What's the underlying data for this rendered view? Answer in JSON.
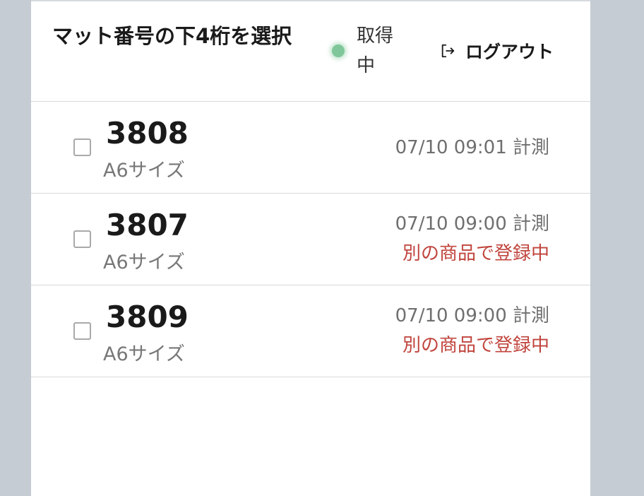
{
  "header": {
    "title": "マット番号の下4桁を選択",
    "status": {
      "label": "取得中",
      "color": "#7fc79a"
    },
    "logout": {
      "label": "ログアウト",
      "icon": "logout-icon"
    }
  },
  "mats": [
    {
      "number": "3808",
      "size": "A6サイズ",
      "measured": "07/10 09:01 計測",
      "warning": "",
      "checked": false
    },
    {
      "number": "3807",
      "size": "A6サイズ",
      "measured": "07/10 09:00 計測",
      "warning": "別の商品で登録中",
      "checked": false
    },
    {
      "number": "3809",
      "size": "A6サイズ",
      "measured": "07/10 09:00 計測",
      "warning": "別の商品で登録中",
      "checked": false
    }
  ],
  "colors": {
    "warning": "#c0443c",
    "background": "#c5ccd3"
  }
}
